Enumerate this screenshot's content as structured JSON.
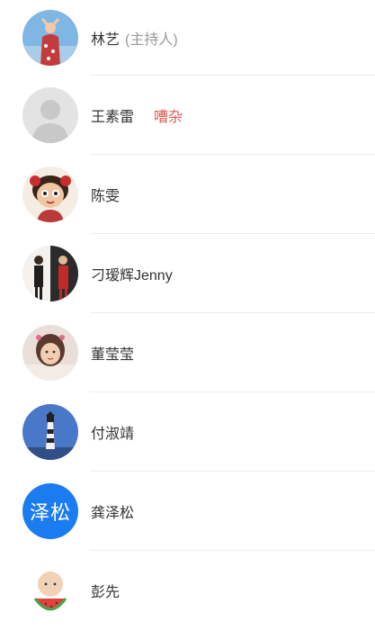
{
  "members": [
    {
      "name": "林艺",
      "role": "(主持人)",
      "tag": "",
      "avatar_icon": "avatar-girl-sky-photo"
    },
    {
      "name": "王素雷",
      "role": "",
      "tag": "嘈杂",
      "avatar_icon": "avatar-default-placeholder"
    },
    {
      "name": "陈雯",
      "role": "",
      "tag": "",
      "avatar_icon": "avatar-cartoon-girl"
    },
    {
      "name": "刁瑷辉Jenny",
      "role": "",
      "tag": "",
      "avatar_icon": "avatar-two-women-photo"
    },
    {
      "name": "董莹莹",
      "role": "",
      "tag": "",
      "avatar_icon": "avatar-child-photo"
    },
    {
      "name": "付淑靖",
      "role": "",
      "tag": "",
      "avatar_icon": "avatar-lighthouse-photo"
    },
    {
      "name": "龚泽松",
      "role": "",
      "tag": "",
      "avatar_icon": "avatar-text",
      "avatar_text": "泽松",
      "avatar_color": "#1a7cf0"
    },
    {
      "name": "彭先",
      "role": "",
      "tag": "",
      "avatar_icon": "avatar-baby-watermelon-photo"
    }
  ],
  "colors": {
    "tag": "#e0574f",
    "role": "#9a9a9a",
    "name": "#333333"
  }
}
